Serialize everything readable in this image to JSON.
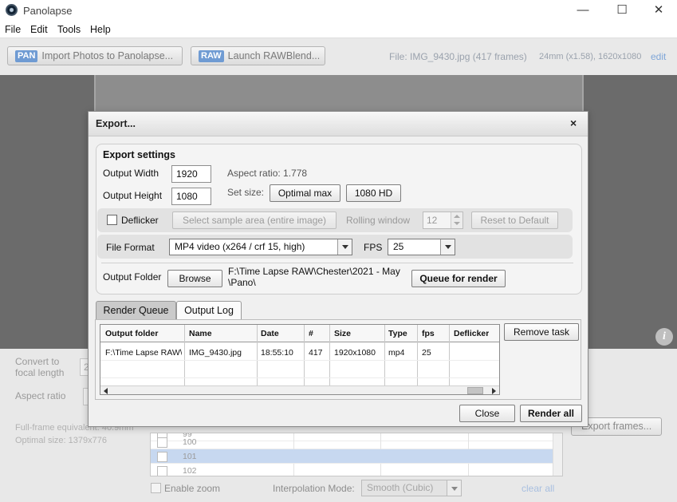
{
  "app": {
    "title": "Panolapse",
    "window_controls": {
      "minimize": "—",
      "maximize": "☐",
      "close": "✕"
    }
  },
  "menu": [
    "File",
    "Edit",
    "Tools",
    "Help"
  ],
  "toolbar": {
    "import_badge": "PAN",
    "import_label": "Import Photos to Panolapse...",
    "raw_badge": "RAW",
    "raw_label": "Launch RAWBlend...",
    "file_info": "File: IMG_9430.jpg (417 frames)",
    "lens_info": "24mm (x1.58), 1620x1080",
    "edit_link": "edit"
  },
  "background_panel": {
    "convert_label_1": "Convert to",
    "convert_label_2": "focal length",
    "convert_value": "2",
    "aspect_label": "Aspect ratio",
    "full_frame_text": "Full-frame equivalent: 40.9mm",
    "optimal_size_text": "Optimal size: 1379x776",
    "frame_rows": [
      {
        "num": "99",
        "selected": false
      },
      {
        "num": "100",
        "selected": false
      },
      {
        "num": "101",
        "selected": true
      },
      {
        "num": "102",
        "selected": false
      }
    ],
    "export_frames_label": "Export frames...",
    "enable_zoom_label": "Enable zoom",
    "interp_label": "Interpolation Mode:",
    "interp_value": "Smooth (Cubic)",
    "clear_all": "clear all"
  },
  "dialog": {
    "title": "Export...",
    "close": "×",
    "settings_title": "Export settings",
    "output_width_label": "Output Width",
    "output_width_value": "1920",
    "output_height_label": "Output Height",
    "output_height_value": "1080",
    "aspect_ratio_text": "Aspect ratio: 1.778",
    "set_size_label": "Set size:",
    "optimal_max_label": "Optimal max",
    "hd_label": "1080 HD",
    "deflicker_label": "Deflicker",
    "deflicker_checked": false,
    "sample_area_label": "Select sample area (entire image)",
    "rolling_window_label": "Rolling window",
    "rolling_window_value": "12",
    "reset_label": "Reset to Default",
    "file_format_label": "File Format",
    "file_format_value": "MP4 video (x264 / crf 15, high)",
    "fps_label": "FPS",
    "fps_value": "25",
    "output_folder_label": "Output Folder",
    "browse_label": "Browse",
    "output_folder_path_1": "F:\\Time Lapse RAW\\Chester\\2021 - May",
    "output_folder_path_2": "\\Pano\\",
    "queue_render_label": "Queue for render",
    "tabs": [
      {
        "label": "Render Queue",
        "active": true
      },
      {
        "label": "Output Log",
        "active": false
      }
    ],
    "queue_columns": [
      "Output folder",
      "Name",
      "Date",
      "#",
      "Size",
      "Type",
      "fps",
      "Deflicker"
    ],
    "queue_rows": [
      {
        "folder": "F:\\Time Lapse RAW\\",
        "name": "IMG_9430.jpg",
        "date": "18:55:10",
        "count": "417",
        "size": "1920x1080",
        "type": "mp4",
        "fps": "25",
        "deflicker": ""
      }
    ],
    "remove_task_label": "Remove task",
    "close_label": "Close",
    "render_all_label": "Render all"
  }
}
